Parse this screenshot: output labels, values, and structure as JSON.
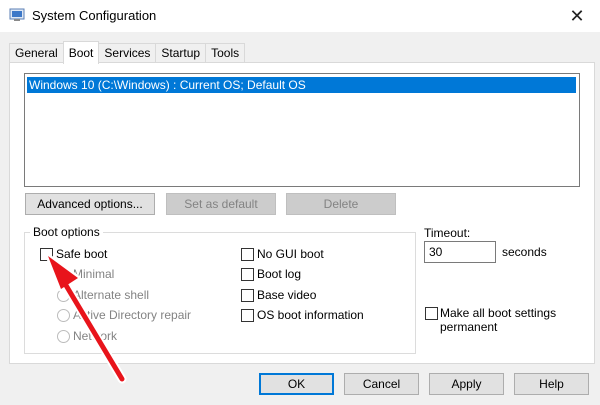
{
  "window": {
    "title": "System Configuration",
    "close_glyph": "✕"
  },
  "tabs": [
    {
      "label": "General",
      "active": false
    },
    {
      "label": "Boot",
      "active": true
    },
    {
      "label": "Services",
      "active": false
    },
    {
      "label": "Startup",
      "active": false
    },
    {
      "label": "Tools",
      "active": false
    }
  ],
  "os_list": {
    "items": [
      "Windows 10 (C:\\Windows) : Current OS; Default OS"
    ],
    "selected_index": 0
  },
  "os_buttons": {
    "advanced": "Advanced options...",
    "set_default": "Set as default",
    "delete": "Delete"
  },
  "boot_options": {
    "title": "Boot options",
    "safe_boot": {
      "label": "Safe boot",
      "checked": false
    },
    "radios": [
      {
        "label": "Minimal",
        "enabled": false
      },
      {
        "label": "Alternate shell",
        "enabled": false
      },
      {
        "label": "Active Directory repair",
        "enabled": false
      },
      {
        "label": "Network",
        "enabled": false
      }
    ],
    "right_checks": [
      {
        "label": "No GUI boot",
        "checked": false
      },
      {
        "label": "Boot log",
        "checked": false
      },
      {
        "label": "Base video",
        "checked": false
      },
      {
        "label": "OS boot information",
        "checked": false
      }
    ]
  },
  "timeout": {
    "label": "Timeout:",
    "value": "30",
    "unit": "seconds"
  },
  "make_permanent": {
    "label_line1": "Make all boot settings",
    "label_line2": "permanent",
    "checked": false
  },
  "footer": {
    "ok": "OK",
    "cancel": "Cancel",
    "apply": "Apply",
    "help": "Help"
  },
  "colors": {
    "selection": "#0078d7",
    "annotation_arrow": "#e8141b"
  }
}
